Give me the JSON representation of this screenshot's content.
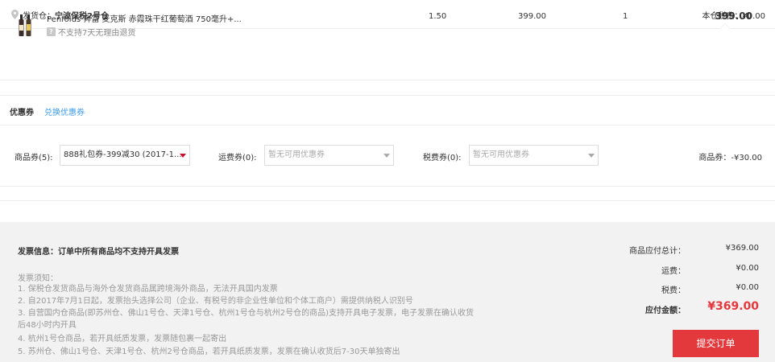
{
  "warehouse": {
    "label": "发货仓：",
    "name": "宁波保税2号仓",
    "tax_label": "本仓税费：",
    "tax_value": "¥0.00"
  },
  "product": {
    "name": "Penfolds 奔富 麦克斯 赤霞珠干红葡萄酒 750毫升+...",
    "return_note": "不支持7天无理由退货",
    "return_icon_char": "?",
    "weight": "1.50",
    "price": "399.00",
    "qty": "1",
    "total": "399.00"
  },
  "coupon": {
    "title": "优惠券",
    "redeem_link": "兑换优惠券",
    "goods_label": "商品券(5):",
    "goods_selected": "888礼包券-399减30 (2017-1...",
    "shipping_label": "运费券(0):",
    "shipping_placeholder": "暂无可用优惠券",
    "tax_label": "税费券(0):",
    "tax_placeholder": "暂无可用优惠券",
    "discount_text": "商品券：-¥30.00"
  },
  "invoice": {
    "title": "发票信息：订单中所有商品均不支持开具发票",
    "notes_head": "发票须知：",
    "notes": [
      "1. 保税仓发货商品与海外仓发货商品属跨境海外商品，无法开具国内发票",
      "2. 自2017年7月1日起，发票抬头选择公司（企业、有税号的非企业性单位和个体工商户）需提供纳税人识别号",
      "3. 自营国内仓商品(即苏州仓、佛山1号仓、天津1号仓、杭州1号仓与杭州2号仓的商品)支持开具电子发票，电子发票在确认收货后48小时内开具",
      "4. 杭州1号仓商品，若开具纸质发票，发票随包裹一起寄出",
      "5. 苏州仓、佛山1号仓、天津1号仓、杭州2号仓商品，若开具纸质发票，发票在确认收货后7-30天单独寄出"
    ]
  },
  "summary": {
    "goods_label": "商品应付总计：",
    "goods_value": "¥369.00",
    "shipping_label": "运费：",
    "shipping_value": "¥0.00",
    "tax_label": "税费：",
    "tax_value": "¥0.00",
    "total_label": "应付金额：",
    "total_value": "¥369.00",
    "submit_label": "提交订单"
  },
  "colors": {
    "accent": "#e4393c",
    "link": "#3d9be9",
    "panel_bg": "#f2f2f2"
  }
}
